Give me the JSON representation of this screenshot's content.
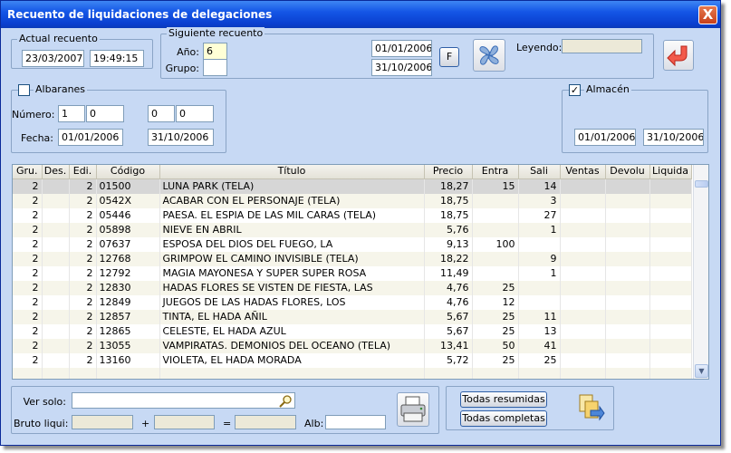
{
  "window": {
    "title": "Recuento de liquidaciones de delegaciones",
    "close_glyph": "X"
  },
  "actual": {
    "legend": "Actual recuento",
    "date": "23/03/2007",
    "time": "19:49:15"
  },
  "siguiente": {
    "legend": "Siguiente recuento",
    "ano_label": "Año:",
    "ano_value": "6",
    "grupo_label": "Grupo:",
    "grupo_value": "",
    "date_from": "01/01/2006",
    "date_to": "31/10/2006",
    "f_button": "F",
    "leyendo_label": "Leyendo:",
    "leyendo_value": ""
  },
  "albaranes": {
    "legend": "Albaranes",
    "checked": false,
    "numero_label": "Número:",
    "num1": "1",
    "num2": "0",
    "num3": "0",
    "num4": "0",
    "fecha_label": "Fecha:",
    "fecha_from": "01/01/2006",
    "fecha_to": "31/10/2006"
  },
  "almacen": {
    "legend": "Almacén",
    "checked": true,
    "check_glyph": "✓",
    "date_from": "01/01/2006",
    "date_to": "31/10/2006"
  },
  "grid": {
    "columns": [
      "Gru.",
      "Des.",
      "Edi.",
      "Código",
      "Título",
      "Precio",
      "Entra",
      "Sali",
      "Ventas",
      "Devolu",
      "Liquida"
    ],
    "rows": [
      {
        "gru": "2",
        "des": "",
        "edi": "2",
        "codigo": "01500",
        "titulo": "LUNA PARK (TELA)",
        "precio": "18,27",
        "entra": "15",
        "sali": "14",
        "ventas": "",
        "devolu": "",
        "liquida": ""
      },
      {
        "gru": "2",
        "des": "",
        "edi": "2",
        "codigo": "0542X",
        "titulo": "ACABAR CON EL PERSONAJE (TELA)",
        "precio": "18,75",
        "entra": "",
        "sali": "3",
        "ventas": "",
        "devolu": "",
        "liquida": ""
      },
      {
        "gru": "2",
        "des": "",
        "edi": "2",
        "codigo": "05446",
        "titulo": "PAESA. EL ESPIA DE LAS MIL CARAS (TELA)",
        "precio": "18,75",
        "entra": "",
        "sali": "27",
        "ventas": "",
        "devolu": "",
        "liquida": ""
      },
      {
        "gru": "2",
        "des": "",
        "edi": "2",
        "codigo": "05898",
        "titulo": "NIEVE EN ABRIL",
        "precio": "5,76",
        "entra": "",
        "sali": "1",
        "ventas": "",
        "devolu": "",
        "liquida": ""
      },
      {
        "gru": "2",
        "des": "",
        "edi": "2",
        "codigo": "07637",
        "titulo": "ESPOSA DEL DIOS DEL FUEGO, LA",
        "precio": "9,13",
        "entra": "100",
        "sali": "",
        "ventas": "",
        "devolu": "",
        "liquida": ""
      },
      {
        "gru": "2",
        "des": "",
        "edi": "2",
        "codigo": "12768",
        "titulo": "GRIMPOW EL CAMINO INVISIBLE (TELA)",
        "precio": "18,22",
        "entra": "",
        "sali": "9",
        "ventas": "",
        "devolu": "",
        "liquida": ""
      },
      {
        "gru": "2",
        "des": "",
        "edi": "2",
        "codigo": "12792",
        "titulo": "MAGIA MAYONESA Y SUPER SUPER ROSA",
        "precio": "11,49",
        "entra": "",
        "sali": "1",
        "ventas": "",
        "devolu": "",
        "liquida": ""
      },
      {
        "gru": "2",
        "des": "",
        "edi": "2",
        "codigo": "12830",
        "titulo": "HADAS FLORES SE VISTEN DE FIESTA, LAS",
        "precio": "4,76",
        "entra": "25",
        "sali": "",
        "ventas": "",
        "devolu": "",
        "liquida": ""
      },
      {
        "gru": "2",
        "des": "",
        "edi": "2",
        "codigo": "12849",
        "titulo": "JUEGOS DE LAS HADAS FLORES, LOS",
        "precio": "4,76",
        "entra": "12",
        "sali": "",
        "ventas": "",
        "devolu": "",
        "liquida": ""
      },
      {
        "gru": "2",
        "des": "",
        "edi": "2",
        "codigo": "12857",
        "titulo": "TINTA, EL HADA AÑIL",
        "precio": "5,67",
        "entra": "25",
        "sali": "11",
        "ventas": "",
        "devolu": "",
        "liquida": ""
      },
      {
        "gru": "2",
        "des": "",
        "edi": "2",
        "codigo": "12865",
        "titulo": "CELESTE, EL HADA AZUL",
        "precio": "5,67",
        "entra": "25",
        "sali": "13",
        "ventas": "",
        "devolu": "",
        "liquida": ""
      },
      {
        "gru": "2",
        "des": "",
        "edi": "2",
        "codigo": "13055",
        "titulo": "VAMPIRATAS. DEMONIOS DEL OCEANO (TELA)",
        "precio": "13,41",
        "entra": "50",
        "sali": "41",
        "ventas": "",
        "devolu": "",
        "liquida": ""
      },
      {
        "gru": "2",
        "des": "",
        "edi": "2",
        "codigo": "13160",
        "titulo": "VIOLETA, EL HADA MORADA",
        "precio": "5,72",
        "entra": "25",
        "sali": "25",
        "ventas": "",
        "devolu": "",
        "liquida": ""
      },
      {
        "gru": "",
        "des": "",
        "edi": "",
        "codigo": "",
        "titulo": "",
        "precio": "",
        "entra": "",
        "sali": "",
        "ventas": "",
        "devolu": "",
        "liquida": ""
      }
    ],
    "scroll_up": "▲",
    "scroll_down": "▼"
  },
  "bottom": {
    "ver_solo_label": "Ver solo:",
    "ver_solo_value": "",
    "bruto_label": "Bruto liqui:",
    "bruto1": "",
    "plus": "+",
    "bruto2": "",
    "equals": "=",
    "bruto3": "",
    "alb_label": "Alb:",
    "alb_value": "",
    "todas_resumidas": "Todas resumidas",
    "todas_completas": "Todas completas"
  },
  "icons": {
    "fan": "fan-icon",
    "exit": "exit-arrow-icon",
    "search": "magnifier-icon",
    "printer": "printer-icon",
    "export": "export-icon"
  },
  "colors": {
    "window_bg": "#c7d9f4",
    "titlebar": "#0a3fcf",
    "field_highlight": "#ffffd6",
    "selected_row": "#d6d6d6"
  }
}
